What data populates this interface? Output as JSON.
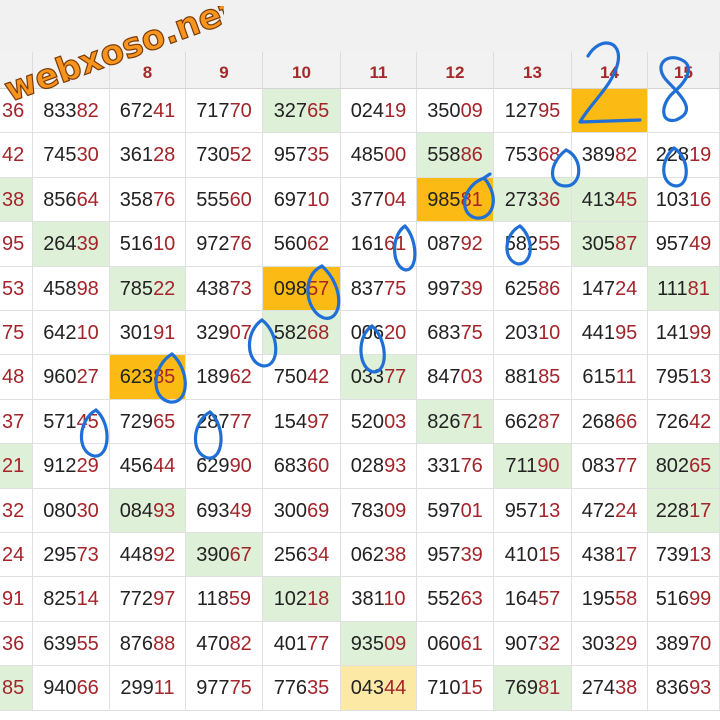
{
  "site": {
    "watermark": "webxoso.net"
  },
  "colors": {
    "header_text": "#a52a2a",
    "tail_digits": "#a3242a",
    "head_digits": "#222222",
    "highlight_green": "#dff0d8",
    "highlight_orange": "#fbbb14",
    "highlight_cream": "#fde9a6",
    "ink": "#1f6fd6"
  },
  "table": {
    "columns": [
      "",
      "",
      "8",
      "9",
      "10",
      "11",
      "12",
      "13",
      "14",
      "15"
    ],
    "rows": [
      [
        "36",
        "83382",
        "67241",
        "71770",
        "32765",
        "02419",
        "35009",
        "12795",
        "",
        ""
      ],
      [
        "42",
        "74530",
        "36128",
        "73052",
        "95735",
        "48500",
        "55886",
        "75368",
        "38982",
        "22819"
      ],
      [
        "38",
        "85664",
        "35876",
        "55560",
        "69710",
        "37704",
        "98581",
        "27336",
        "41345",
        "10316"
      ],
      [
        "95",
        "26439",
        "51610",
        "97276",
        "56062",
        "16161",
        "08792",
        "58255",
        "30587",
        "95749"
      ],
      [
        "53",
        "45898",
        "78522",
        "43873",
        "09857",
        "83775",
        "99739",
        "62586",
        "14724",
        "11181"
      ],
      [
        "75",
        "64210",
        "30191",
        "32907",
        "58268",
        "00620",
        "68375",
        "20310",
        "44195",
        "14199"
      ],
      [
        "48",
        "96027",
        "62385",
        "18962",
        "75042",
        "03377",
        "84703",
        "88185",
        "61511",
        "79513"
      ],
      [
        "37",
        "57145",
        "72965",
        "28777",
        "15497",
        "52003",
        "82671",
        "66287",
        "26866",
        "72642"
      ],
      [
        "21",
        "91229",
        "45644",
        "62990",
        "68360",
        "02893",
        "33176",
        "71190",
        "08377",
        "80265"
      ],
      [
        "32",
        "08030",
        "08493",
        "69349",
        "30069",
        "78309",
        "59701",
        "95713",
        "47224",
        "22817"
      ],
      [
        "24",
        "29573",
        "44892",
        "39067",
        "25634",
        "06238",
        "95739",
        "41015",
        "43817",
        "73913"
      ],
      [
        "91",
        "82514",
        "77297",
        "11859",
        "10218",
        "38110",
        "55263",
        "16457",
        "19558",
        "51699"
      ],
      [
        "36",
        "63955",
        "87688",
        "47082",
        "40177",
        "93509",
        "06061",
        "90732",
        "30329",
        "38970"
      ],
      [
        "85",
        "94066",
        "29911",
        "97775",
        "77635",
        "04344",
        "71015",
        "76981",
        "27438",
        "83693"
      ]
    ],
    "highlights": [
      {
        "row": 0,
        "col": 4,
        "kind": "green"
      },
      {
        "row": 0,
        "col": 8,
        "kind": "orange"
      },
      {
        "row": 1,
        "col": 6,
        "kind": "green"
      },
      {
        "row": 2,
        "col": 0,
        "kind": "green"
      },
      {
        "row": 2,
        "col": 6,
        "kind": "orange"
      },
      {
        "row": 2,
        "col": 7,
        "kind": "green"
      },
      {
        "row": 2,
        "col": 8,
        "kind": "green"
      },
      {
        "row": 3,
        "col": 1,
        "kind": "green"
      },
      {
        "row": 3,
        "col": 8,
        "kind": "green"
      },
      {
        "row": 4,
        "col": 2,
        "kind": "green"
      },
      {
        "row": 4,
        "col": 4,
        "kind": "orange"
      },
      {
        "row": 4,
        "col": 9,
        "kind": "green"
      },
      {
        "row": 5,
        "col": 4,
        "kind": "green"
      },
      {
        "row": 6,
        "col": 2,
        "kind": "orange"
      },
      {
        "row": 6,
        "col": 5,
        "kind": "green"
      },
      {
        "row": 7,
        "col": 6,
        "kind": "green"
      },
      {
        "row": 8,
        "col": 0,
        "kind": "green"
      },
      {
        "row": 8,
        "col": 7,
        "kind": "green"
      },
      {
        "row": 8,
        "col": 9,
        "kind": "green"
      },
      {
        "row": 9,
        "col": 2,
        "kind": "green"
      },
      {
        "row": 9,
        "col": 9,
        "kind": "green"
      },
      {
        "row": 10,
        "col": 3,
        "kind": "green"
      },
      {
        "row": 11,
        "col": 4,
        "kind": "green"
      },
      {
        "row": 12,
        "col": 5,
        "kind": "green"
      },
      {
        "row": 13,
        "col": 0,
        "kind": "green"
      },
      {
        "row": 13,
        "col": 5,
        "kind": "cream"
      },
      {
        "row": 13,
        "col": 7,
        "kind": "green"
      }
    ]
  },
  "annotations": {
    "handwritten_numbers": [
      "2",
      "8"
    ]
  }
}
